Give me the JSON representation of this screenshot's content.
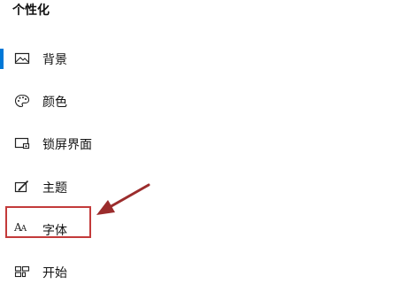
{
  "page": {
    "title": "个性化"
  },
  "nav": {
    "items": [
      {
        "label": "背景",
        "icon": "picture-icon",
        "selected": true
      },
      {
        "label": "颜色",
        "icon": "palette-icon",
        "selected": false
      },
      {
        "label": "锁屏界面",
        "icon": "lock-screen-icon",
        "selected": false
      },
      {
        "label": "主题",
        "icon": "theme-brush-icon",
        "selected": false
      },
      {
        "label": "字体",
        "icon": "font-icon",
        "selected": false,
        "icon_text": "A",
        "icon_text_small": "A"
      },
      {
        "label": "开始",
        "icon": "start-tiles-icon",
        "selected": false
      }
    ]
  },
  "colors": {
    "accent": "#0078d7",
    "highlight_border": "#c33a3a",
    "annotation_arrow": "#9b2c2c"
  }
}
